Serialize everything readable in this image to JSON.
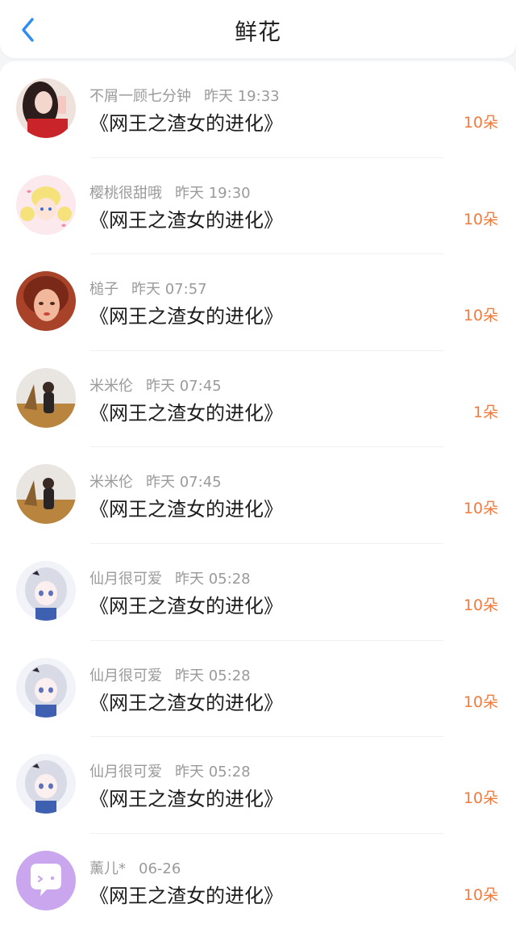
{
  "header": {
    "title": "鲜花"
  },
  "colors": {
    "accent": "#2f8cf0",
    "amount": "#f07b3f"
  },
  "items": [
    {
      "user": "不屑一顾七分钟",
      "time": "昨天 19:33",
      "book": "《网王之渣女的进化》",
      "amount": "10朵",
      "avatar": "girl-red-avatar"
    },
    {
      "user": "樱桃很甜哦",
      "time": "昨天 19:30",
      "book": "《网王之渣女的进化》",
      "amount": "10朵",
      "avatar": "sailor-moon-avatar"
    },
    {
      "user": "槌子",
      "time": "昨天 07:57",
      "book": "《网王之渣女的进化》",
      "amount": "10朵",
      "avatar": "painted-girl-avatar"
    },
    {
      "user": "米米伦",
      "time": "昨天 07:45",
      "book": "《网王之渣女的进化》",
      "amount": "1朵",
      "avatar": "field-boy-avatar"
    },
    {
      "user": "米米伦",
      "time": "昨天 07:45",
      "book": "《网王之渣女的进化》",
      "amount": "10朵",
      "avatar": "field-boy-avatar"
    },
    {
      "user": "仙月很可爱",
      "time": "昨天 05:28",
      "book": "《网王之渣女的进化》",
      "amount": "10朵",
      "avatar": "anime-girl-avatar"
    },
    {
      "user": "仙月很可爱",
      "time": "昨天 05:28",
      "book": "《网王之渣女的进化》",
      "amount": "10朵",
      "avatar": "anime-girl-avatar"
    },
    {
      "user": "仙月很可爱",
      "time": "昨天 05:28",
      "book": "《网王之渣女的进化》",
      "amount": "10朵",
      "avatar": "anime-girl-avatar"
    },
    {
      "user": "薰儿*",
      "time": "06-26",
      "book": "《网王之渣女的进化》",
      "amount": "10朵",
      "avatar": "default-chat-avatar"
    }
  ]
}
